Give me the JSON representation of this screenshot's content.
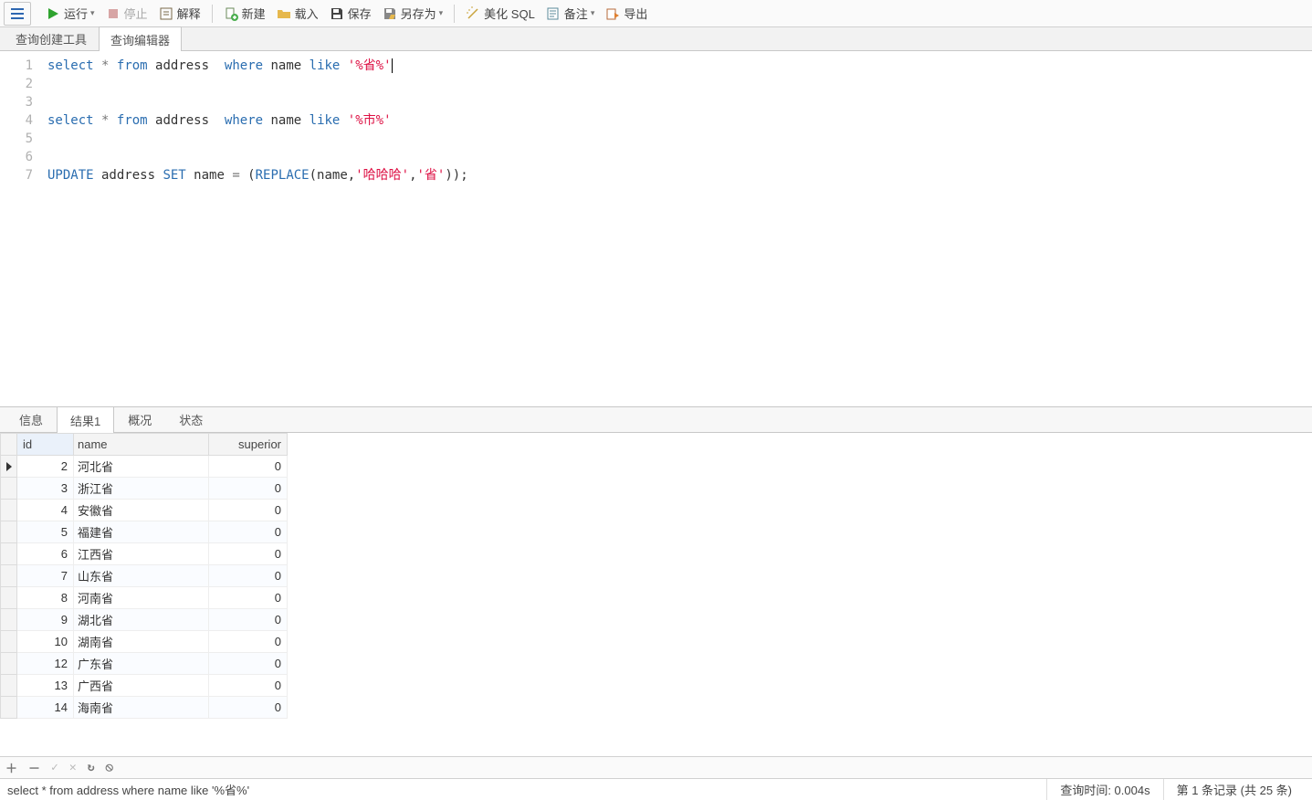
{
  "toolbar": {
    "run": "运行",
    "stop": "停止",
    "explain": "解释",
    "new": "新建",
    "load": "载入",
    "save": "保存",
    "save_as": "另存为",
    "beautify": "美化 SQL",
    "notes": "备注",
    "export": "导出"
  },
  "tabs": {
    "builder": "查询创建工具",
    "editor": "查询编辑器"
  },
  "sql_lines": [
    {
      "n": 1,
      "tokens": [
        [
          "kw",
          "select"
        ],
        [
          "",
          " "
        ],
        [
          "op",
          "*"
        ],
        [
          "",
          " "
        ],
        [
          "kw",
          "from"
        ],
        [
          "",
          " address  "
        ],
        [
          "kw",
          "where"
        ],
        [
          "",
          " name "
        ],
        [
          "kw",
          "like"
        ],
        [
          "",
          " "
        ],
        [
          "str",
          "'%省%'"
        ]
      ],
      "cursor": true
    },
    {
      "n": 2,
      "tokens": []
    },
    {
      "n": 3,
      "tokens": []
    },
    {
      "n": 4,
      "tokens": [
        [
          "kw",
          "select"
        ],
        [
          "",
          " "
        ],
        [
          "op",
          "*"
        ],
        [
          "",
          " "
        ],
        [
          "kw",
          "from"
        ],
        [
          "",
          " address  "
        ],
        [
          "kw",
          "where"
        ],
        [
          "",
          " name "
        ],
        [
          "kw",
          "like"
        ],
        [
          "",
          " "
        ],
        [
          "str",
          "'%市%'"
        ]
      ]
    },
    {
      "n": 5,
      "tokens": []
    },
    {
      "n": 6,
      "tokens": []
    },
    {
      "n": 7,
      "tokens": [
        [
          "kw",
          "UPDATE"
        ],
        [
          "",
          " address "
        ],
        [
          "kw",
          "SET"
        ],
        [
          "",
          " name "
        ],
        [
          "op",
          "="
        ],
        [
          "",
          " ("
        ],
        [
          "fn",
          "REPLACE"
        ],
        [
          "",
          "(name,"
        ],
        [
          "str",
          "'哈哈哈'"
        ],
        [
          "",
          ","
        ],
        [
          "str",
          "'省'"
        ],
        [
          "",
          "));"
        ]
      ]
    }
  ],
  "result_tabs": {
    "info": "信息",
    "result": "结果1",
    "profile": "概况",
    "status": "状态"
  },
  "columns": [
    "id",
    "name",
    "superior"
  ],
  "rows": [
    {
      "id": 2,
      "name": "河北省",
      "superior": 0
    },
    {
      "id": 3,
      "name": "浙江省",
      "superior": 0
    },
    {
      "id": 4,
      "name": "安徽省",
      "superior": 0
    },
    {
      "id": 5,
      "name": "福建省",
      "superior": 0
    },
    {
      "id": 6,
      "name": "江西省",
      "superior": 0
    },
    {
      "id": 7,
      "name": "山东省",
      "superior": 0
    },
    {
      "id": 8,
      "name": "河南省",
      "superior": 0
    },
    {
      "id": 9,
      "name": "湖北省",
      "superior": 0
    },
    {
      "id": 10,
      "name": "湖南省",
      "superior": 0
    },
    {
      "id": 12,
      "name": "广东省",
      "superior": 0
    },
    {
      "id": 13,
      "name": "广西省",
      "superior": 0
    },
    {
      "id": 14,
      "name": "海南省",
      "superior": 0
    }
  ],
  "status": {
    "query": "select * from address  where name like '%省%'",
    "time": "查询时间: 0.004s",
    "records": "第 1 条记录 (共 25 条)"
  }
}
